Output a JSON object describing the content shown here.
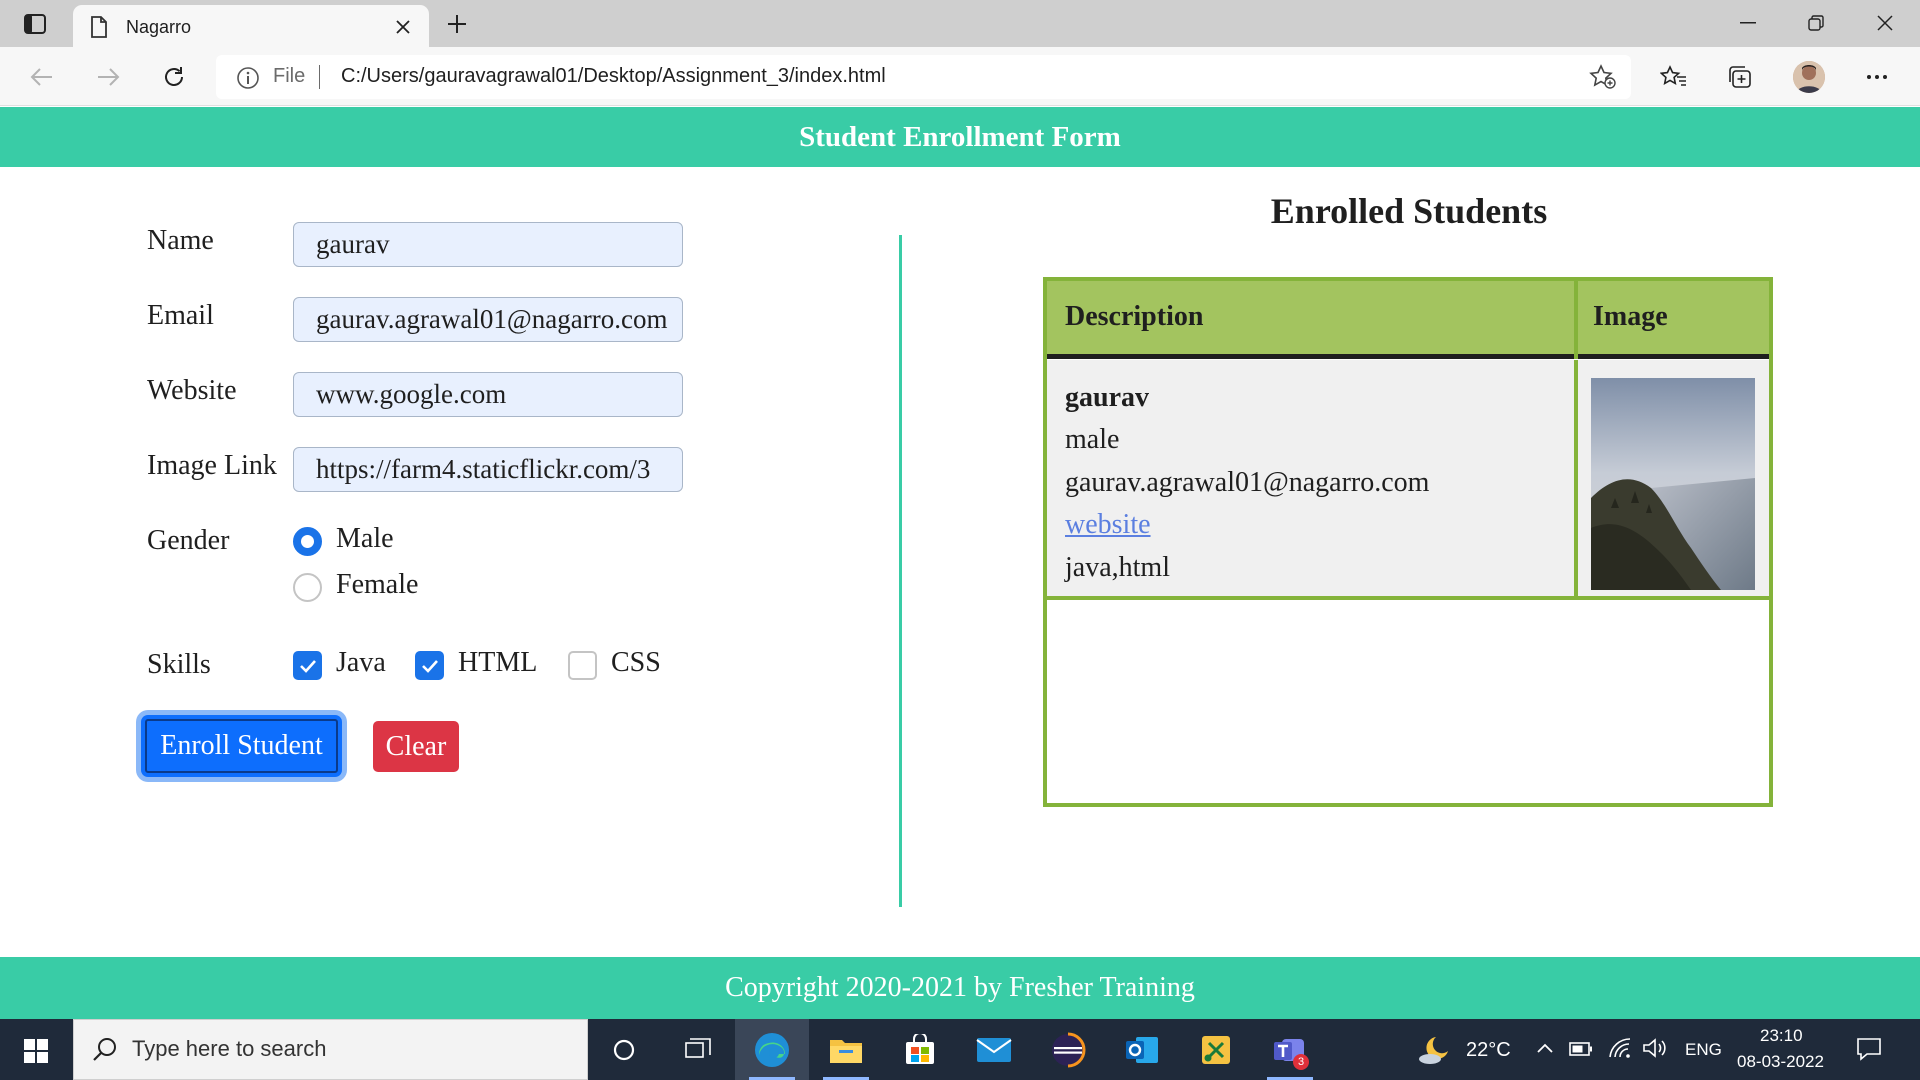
{
  "browser": {
    "tab_title": "Nagarro",
    "address_scheme": "File",
    "address_url": "C:/Users/gauravagrawal01/Desktop/Assignment_3/index.html"
  },
  "header": {
    "title": "Student Enrollment Form"
  },
  "form": {
    "name_label": "Name",
    "name_value": "gaurav",
    "email_label": "Email",
    "email_value": "gaurav.agrawal01@nagarro.com",
    "website_label": "Website",
    "website_value": "www.google.com",
    "image_label": "Image Link",
    "image_value": "https://farm4.staticflickr.com/3",
    "gender_label": "Gender",
    "gender_options": [
      "Male",
      "Female"
    ],
    "gender_selected": "Male",
    "skills_label": "Skills",
    "skills": [
      {
        "label": "Java",
        "checked": true
      },
      {
        "label": "HTML",
        "checked": true
      },
      {
        "label": "CSS",
        "checked": false
      }
    ],
    "enroll_button": "Enroll Student",
    "clear_button": "Clear"
  },
  "enrolled": {
    "title": "Enrolled Students",
    "columns": [
      "Description",
      "Image"
    ],
    "rows": [
      {
        "name": "gaurav",
        "gender": "male",
        "email": "gaurav.agrawal01@nagarro.com",
        "website_link": "website",
        "skills": "java,html"
      }
    ]
  },
  "footer": {
    "text": "Copyright 2020-2021 by Fresher Training"
  },
  "taskbar": {
    "search_placeholder": "Type here to search",
    "weather": "22°C",
    "language": "ENG",
    "time": "23:10",
    "date": "08-03-2022",
    "teams_badge": "3"
  },
  "colors": {
    "accent": "#39cca6",
    "table_border": "#84b33a",
    "table_header": "#a3c45f",
    "enroll_button": "#0d6efd",
    "clear_button": "#dc3545"
  }
}
